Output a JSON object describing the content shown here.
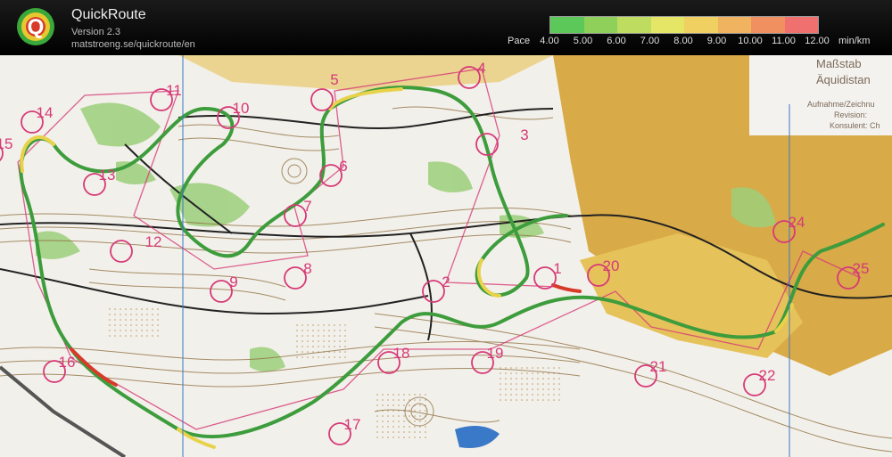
{
  "app": {
    "title": "QuickRoute",
    "version": "Version 2.3",
    "url": "matstroeng.se/quickroute/en",
    "logo_letter": "Q"
  },
  "pace_legend": {
    "label": "Pace",
    "unit": "min/km",
    "ticks": [
      "4.00",
      "5.00",
      "6.00",
      "7.00",
      "8.00",
      "9.00",
      "10.00",
      "11.00",
      "12.00"
    ],
    "colors": [
      "#5cc85a",
      "#8fd05a",
      "#bedc60",
      "#e6e666",
      "#f0d060",
      "#f0b460",
      "#f09060",
      "#f07070"
    ]
  },
  "map": {
    "header_text": [
      "Maßstab",
      "Äquidistan",
      "Aufnahme/Zeichnu",
      "Revision:",
      "Konsulent: Ch"
    ],
    "controls": [
      "1",
      "2",
      "3",
      "4",
      "5",
      "6",
      "7",
      "8",
      "9",
      "10",
      "11",
      "12",
      "13",
      "14",
      "15",
      "16",
      "17",
      "18",
      "19",
      "20",
      "21",
      "22",
      "24",
      "25"
    ],
    "colors": {
      "control": "#d63a78",
      "route_green": "#3d9c3c",
      "route_yellow": "#e8d24a",
      "route_red": "#d83a2a",
      "contour": "#8a6a3a",
      "settlement": "#d8a840",
      "vegetation": "#9ccf7a",
      "water": "#3a78c8"
    }
  }
}
